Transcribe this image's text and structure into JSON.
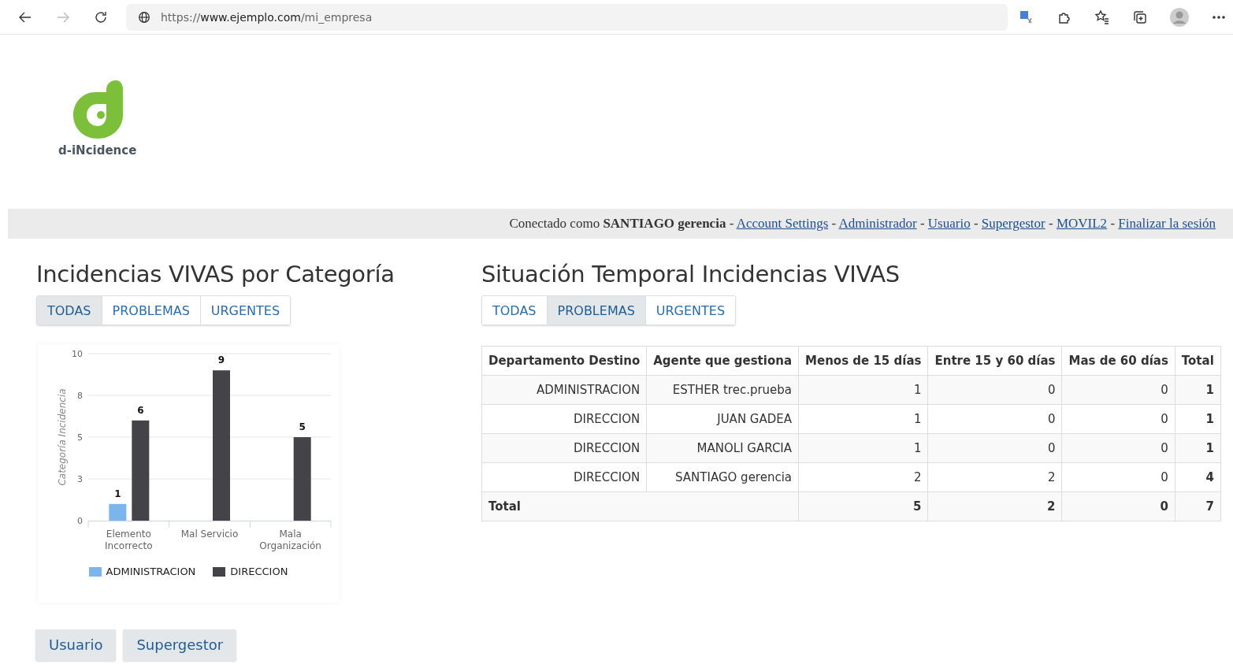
{
  "browser": {
    "url_prefix": "https://",
    "url_host": "www.ejemplo.com",
    "url_path": "/mi_empresa"
  },
  "logo": {
    "text": "d-iNcidence"
  },
  "session": {
    "text": "Conectado como **SANTIAGO gerencia**",
    "separator": "-",
    "links": [
      "Account Settings",
      "Administrador",
      "Usuario",
      "Supergestor",
      "MOVIL2",
      "Finalizar la sesión"
    ]
  },
  "category_panel": {
    "title": "Incidencias VIVAS por Categoría",
    "tabs": [
      {
        "label": "TODAS",
        "selected": true
      },
      {
        "label": "PROBLEMAS",
        "selected": false
      },
      {
        "label": "URGENTES",
        "selected": false
      }
    ],
    "chart_data": {
      "type": "bar",
      "ylabel": "Categoría Incidencia",
      "categories": [
        "Elemento Incorrecto",
        "Mal Servicio",
        "Mala Organización"
      ],
      "series": [
        {
          "name": "ADMINISTRACION",
          "color": "#7cb5ec",
          "values": [
            1,
            null,
            null
          ]
        },
        {
          "name": "DIRECCION",
          "color": "#434348",
          "values": [
            6,
            9,
            5
          ]
        }
      ],
      "ylim": [
        0,
        10
      ],
      "grid": true,
      "yticks": [
        0,
        {
          "value": 2.5,
          "label": "3"
        },
        5,
        {
          "value": 7.5,
          "label": "8"
        },
        10
      ],
      "data_labels": true
    }
  },
  "time_panel": {
    "title": "Situación Temporal Incidencias VIVAS",
    "tabs": [
      {
        "label": "TODAS",
        "selected": false
      },
      {
        "label": "PROBLEMAS",
        "selected": true
      },
      {
        "label": "URGENTES",
        "selected": false
      }
    ],
    "table": {
      "columns": [
        "Departamento Destino",
        "Agente que gestiona",
        "Menos de 15 días",
        "Entre 15 y 60 días",
        "Mas de 60 días",
        "Total"
      ],
      "rows": [
        [
          "ADMINISTRACION",
          "ESTHER trec.prueba",
          "1",
          "0",
          "0",
          "1"
        ],
        [
          "DIRECCION",
          "JUAN GADEA",
          "1",
          "0",
          "0",
          "1"
        ],
        [
          "DIRECCION",
          "MANOLI GARCIA",
          "1",
          "0",
          "0",
          "1"
        ],
        [
          "DIRECCION",
          "SANTIAGO gerencia",
          "2",
          "2",
          "0",
          "4"
        ]
      ],
      "total_row": {
        "label": "Total",
        "values": [
          "5",
          "2",
          "0",
          "7"
        ]
      }
    }
  },
  "buttons": [
    "Usuario",
    "Supergestor"
  ]
}
